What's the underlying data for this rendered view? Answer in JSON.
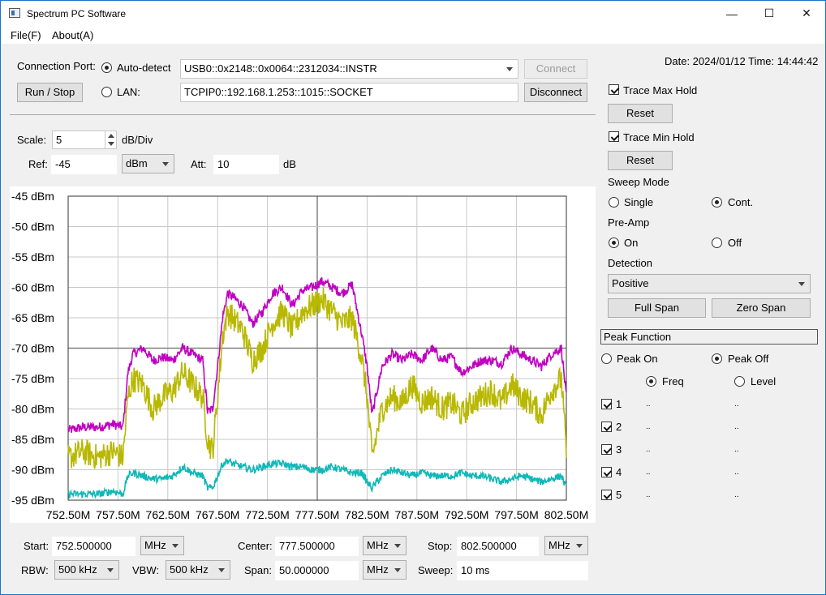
{
  "window": {
    "title": "Spectrum PC Software",
    "minimize": "—",
    "maximize": "☐",
    "close": "✕"
  },
  "menu": {
    "file": "File(F)",
    "about": "About(A)"
  },
  "connection": {
    "port_label": "Connection Port:",
    "autodetect_label": "Auto-detect",
    "lan_label": "LAN:",
    "usb_resource": "USB0::0x2148::0x0064::2312034::INSTR",
    "lan_resource": "TCPIP0::192.168.1.253::1015::SOCKET",
    "connect_label": "Connect",
    "disconnect_label": "Disconnect",
    "run_stop_label": "Run / Stop",
    "mode": "Auto-detect"
  },
  "datetime": "Date: 2024/01/12 Time: 14:44:42",
  "amplitude": {
    "scale_label": "Scale:",
    "scale_value": "5",
    "scale_unit": "dB/Div",
    "ref_label": "Ref:",
    "ref_value": "-45",
    "ref_unit": "dBm",
    "att_label": "Att:",
    "att_value": "10",
    "att_unit": "dB"
  },
  "side": {
    "max_hold_label": "Trace Max Hold",
    "max_hold_checked": true,
    "min_hold_label": "Trace Min Hold",
    "min_hold_checked": true,
    "reset_label": "Reset",
    "sweep_mode_label": "Sweep Mode",
    "single_label": "Single",
    "cont_label": "Cont.",
    "sweep_mode": "Cont.",
    "preamp_label": "Pre-Amp",
    "on_label": "On",
    "off_label": "Off",
    "preamp": "On",
    "detection_label": "Detection",
    "detection_value": "Positive",
    "full_span_label": "Full Span",
    "zero_span_label": "Zero Span",
    "peak_function_label": "Peak Function",
    "peak_on_label": "Peak On",
    "peak_off_label": "Peak Off",
    "peak": "Peak Off",
    "freq_label": "Freq",
    "level_label": "Level",
    "peak_axis": "Freq",
    "markers": [
      {
        "num": "1",
        "freq": "..",
        "level": ".."
      },
      {
        "num": "2",
        "freq": "..",
        "level": ".."
      },
      {
        "num": "3",
        "freq": "..",
        "level": ".."
      },
      {
        "num": "4",
        "freq": "..",
        "level": ".."
      },
      {
        "num": "5",
        "freq": "..",
        "level": ".."
      }
    ]
  },
  "frequency": {
    "start_label": "Start:",
    "start_value": "752.500000",
    "start_unit": "MHz",
    "center_label": "Center:",
    "center_value": "777.500000",
    "center_unit": "MHz",
    "stop_label": "Stop:",
    "stop_value": "802.500000",
    "stop_unit": "MHz",
    "rbw_label": "RBW:",
    "rbw_value": "500 kHz",
    "vbw_label": "VBW:",
    "vbw_value": "500 kHz",
    "span_label": "Span:",
    "span_value": "50.000000",
    "span_unit": "MHz",
    "sweep_label": "Sweep:",
    "sweep_value": "10 ms"
  },
  "chart_data": {
    "type": "line",
    "title": "",
    "xlabel": "",
    "ylabel": "",
    "xlim": [
      752.5,
      802.5
    ],
    "ylim": [
      -95,
      -45
    ],
    "xticks": [
      "752.50M",
      "757.50M",
      "762.50M",
      "767.50M",
      "772.50M",
      "777.50M",
      "782.50M",
      "787.50M",
      "792.50M",
      "797.50M",
      "802.50M"
    ],
    "yticks": [
      "-45 dBm",
      "-50 dBm",
      "-55 dBm",
      "-60 dBm",
      "-65 dBm",
      "-70 dBm",
      "-75 dBm",
      "-80 dBm",
      "-85 dBm",
      "-90 dBm",
      "-95 dBm"
    ],
    "grid": true,
    "colors": {
      "max_hold": "#c000c0",
      "live": "#b8b800",
      "min_hold": "#10b8b8",
      "grid": "#c8c8c8",
      "center": "#808080"
    },
    "series": [
      {
        "color": "#c000c0",
        "x": [
          752.5,
          754,
          755.5,
          757,
          758,
          758.5,
          759,
          760,
          761,
          762,
          763,
          764,
          765,
          766,
          766.5,
          767,
          767.5,
          768,
          768.5,
          769,
          770,
          771,
          772,
          773,
          774,
          775,
          776,
          777,
          778,
          779,
          780,
          781,
          782,
          782.5,
          783,
          784,
          785,
          786,
          787,
          788,
          789,
          790,
          791,
          792,
          793,
          794,
          795,
          796,
          797,
          798,
          799,
          800,
          801,
          802,
          802.5
        ],
        "y": [
          -83.5,
          -83,
          -83,
          -82.5,
          -83,
          -74,
          -71,
          -70,
          -72,
          -71.5,
          -72,
          -70,
          -71,
          -72,
          -80.5,
          -80,
          -73,
          -65,
          -61,
          -61.5,
          -63,
          -66,
          -64,
          -61,
          -60,
          -63,
          -60.5,
          -60,
          -59,
          -60,
          -61,
          -59.5,
          -68,
          -73,
          -81,
          -73,
          -71,
          -72,
          -71,
          -72,
          -70,
          -72,
          -71.5,
          -74,
          -73,
          -72,
          -72,
          -72.5,
          -70,
          -71,
          -72,
          -73,
          -71,
          -70,
          -78
        ]
      },
      {
        "color": "#b8b800",
        "x": [
          752.5,
          754,
          755.5,
          757,
          758,
          758.5,
          759,
          760,
          761,
          762,
          763,
          764,
          765,
          766,
          766.5,
          767,
          767.5,
          768,
          768.5,
          769,
          770,
          771,
          772,
          773,
          774,
          775,
          776,
          777,
          778,
          779,
          780,
          781,
          782,
          782.5,
          783,
          784,
          785,
          786,
          787,
          788,
          789,
          790,
          791,
          792,
          793,
          794,
          795,
          796,
          797,
          798,
          799,
          800,
          801,
          802,
          802.5
        ],
        "y": [
          -88,
          -87,
          -88,
          -87,
          -88,
          -78,
          -75,
          -76,
          -80,
          -78,
          -77,
          -74,
          -76,
          -78,
          -85,
          -87,
          -78,
          -68,
          -64,
          -65,
          -67,
          -72,
          -70,
          -66,
          -64,
          -67,
          -64,
          -63,
          -62,
          -64,
          -66,
          -65,
          -72,
          -78,
          -88,
          -80,
          -78,
          -79,
          -76,
          -79,
          -78,
          -80,
          -79,
          -81,
          -79,
          -78,
          -77,
          -79,
          -76,
          -78,
          -79,
          -81,
          -77,
          -75,
          -87
        ]
      },
      {
        "color": "#10b8b8",
        "x": [
          752.5,
          754,
          755.5,
          757,
          758,
          758.5,
          759,
          760,
          761,
          762,
          763,
          764,
          765,
          766,
          766.5,
          767,
          767.5,
          768,
          768.5,
          769,
          770,
          771,
          772,
          773,
          774,
          775,
          776,
          777,
          778,
          779,
          780,
          781,
          782,
          782.5,
          783,
          784,
          785,
          786,
          787,
          788,
          789,
          790,
          791,
          792,
          793,
          794,
          795,
          796,
          797,
          798,
          799,
          800,
          801,
          802,
          802.5
        ],
        "y": [
          -94,
          -94,
          -94,
          -93.5,
          -94,
          -91,
          -90.5,
          -91,
          -91.5,
          -91.5,
          -91,
          -89.5,
          -90.5,
          -91,
          -93,
          -93,
          -91,
          -89,
          -88.5,
          -89,
          -89.5,
          -90,
          -89.5,
          -89,
          -89,
          -89.5,
          -89.5,
          -90,
          -90,
          -89.5,
          -90,
          -90.5,
          -90.5,
          -92,
          -93,
          -91,
          -90,
          -90.5,
          -91,
          -90.5,
          -91,
          -91,
          -91,
          -90.5,
          -91,
          -91,
          -91.5,
          -92,
          -91.5,
          -91,
          -91.5,
          -92,
          -91.5,
          -91,
          -93
        ]
      }
    ]
  }
}
